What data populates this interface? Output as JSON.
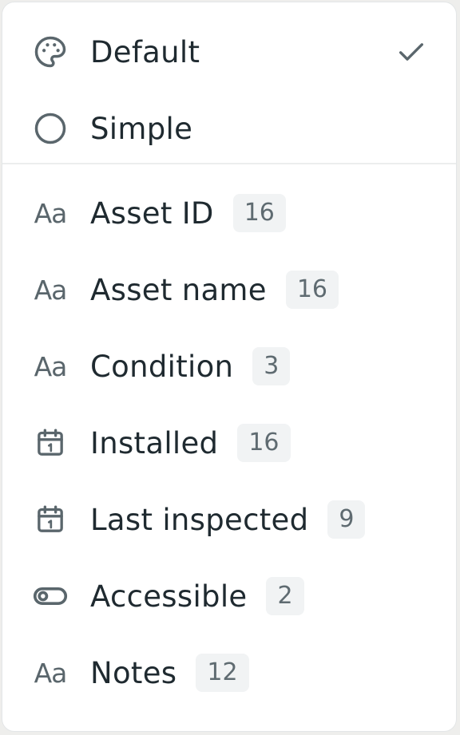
{
  "styles": {
    "items": [
      {
        "label": "Default",
        "icon": "palette-icon",
        "selected": true
      },
      {
        "label": "Simple",
        "icon": "circle-icon",
        "selected": false
      }
    ]
  },
  "fields": {
    "items": [
      {
        "label": "Asset ID",
        "count": "16",
        "icon": "text-type-icon"
      },
      {
        "label": "Asset name",
        "count": "16",
        "icon": "text-type-icon"
      },
      {
        "label": "Condition",
        "count": "3",
        "icon": "text-type-icon"
      },
      {
        "label": "Installed",
        "count": "16",
        "icon": "calendar-icon"
      },
      {
        "label": "Last inspected",
        "count": "9",
        "icon": "calendar-icon"
      },
      {
        "label": "Accessible",
        "count": "2",
        "icon": "toggle-icon"
      },
      {
        "label": "Notes",
        "count": "12",
        "icon": "text-type-icon"
      }
    ]
  },
  "colors": {
    "text": "#1f2a30",
    "icon": "#5a666c",
    "badge_bg": "#f1f3f4",
    "badge_text": "#5f6b71"
  }
}
